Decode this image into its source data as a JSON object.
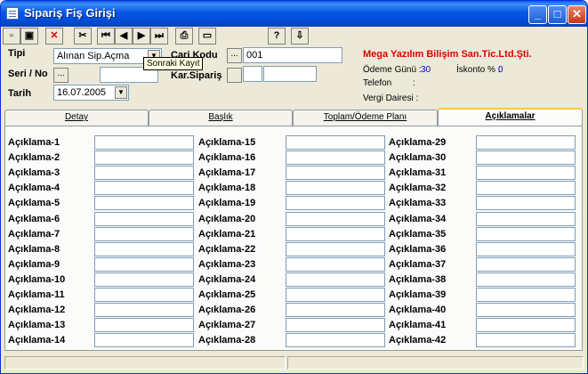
{
  "window": {
    "title": "Sipariş Fiş Girişi",
    "controls": [
      "_",
      "□",
      "✕"
    ]
  },
  "toolbar": {
    "buttons": [
      "new-icon",
      "save-icon",
      "delete-icon",
      "cut-icon",
      "first-icon",
      "prev-icon",
      "next-icon",
      "last-icon",
      "print-icon",
      "preview-icon",
      "help-icon",
      "exit-icon"
    ]
  },
  "form": {
    "tipi_label": "Tipi",
    "tipi_value": "Alınan Sip.Açma",
    "seri_label": "Seri / No",
    "tarih_label": "Tarih",
    "tarih_value": "16.07.2005",
    "cari_label": "Cari Kodu",
    "cari_value": "001",
    "kar_label": "Kar.Sipariş",
    "tooltip": "Sonraki Kayıt",
    "dots": "..."
  },
  "company": {
    "name": "Mega Yazılım Bilişim San.Tic.Ltd.Şti.",
    "odeme_label": "Ödeme Günü :",
    "odeme_value": "30",
    "iskonto_label": "İskonto % :",
    "iskonto_value": "0",
    "telefon_label": "Telefon",
    "telefon_sep": ":",
    "vergi_label": "Vergi Dairesi :"
  },
  "tabs": [
    "Detay",
    "Başlık",
    "Toplam/Ödeme Planı",
    "Açıklamalar"
  ],
  "active_tab": 3,
  "aciklama": {
    "col1": [
      "Açıklama-1",
      "Açıklama-2",
      "Açıklama-3",
      "Açıklama-4",
      "Açıklama-5",
      "Açıklama-6",
      "Açıklama-7",
      "Açıklama-8",
      "Açıklama-9",
      "Açıklama-10",
      "Açıklama-11",
      "Açıklama-12",
      "Açıklama-13",
      "Açıklama-14"
    ],
    "col2": [
      "Açıklama-15",
      "Açıklama-16",
      "Açıklama-17",
      "Açıklama-18",
      "Açıklama-19",
      "Açıklama-20",
      "Açıklama-21",
      "Açıklama-22",
      "Açıklama-23",
      "Açıklama-24",
      "Açıklama-25",
      "Açıklama-26",
      "Açıklama-27",
      "Açıklama-28"
    ],
    "col3": [
      "Açıklama-29",
      "Açıklama-30",
      "Açıklama-31",
      "Açıklama-32",
      "Açıklama-33",
      "Açıklama-34",
      "Açıklama-35",
      "Açıklama-36",
      "Açıklama-37",
      "Açıklama-38",
      "Açıklama-39",
      "Açıklama-40",
      "Açıklama-41",
      "Açıklama-42"
    ]
  }
}
